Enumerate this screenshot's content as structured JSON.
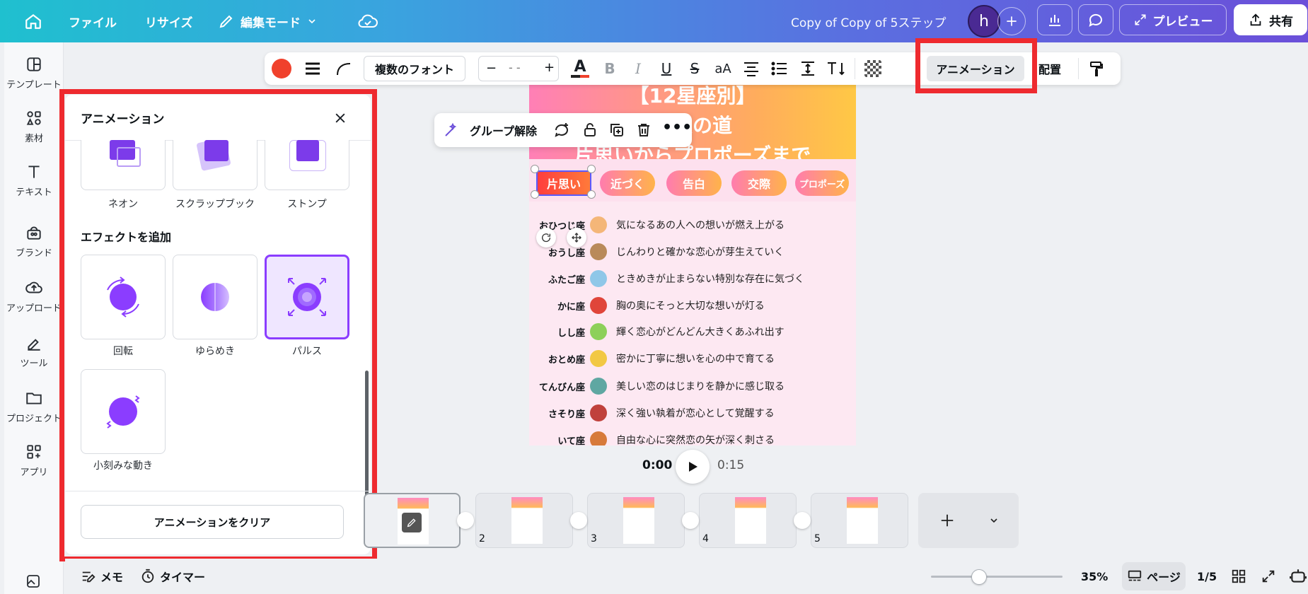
{
  "topbar": {
    "menu_file": "ファイル",
    "menu_resize": "リサイズ",
    "edit_mode": "編集モード",
    "doc_title": "Copy of Copy of 5ステップ",
    "avatar_initial": "h",
    "preview": "プレビュー",
    "share": "共有"
  },
  "sidebar": {
    "items": [
      {
        "label": "テンプレート",
        "icon": "template-icon"
      },
      {
        "label": "素材",
        "icon": "elements-icon"
      },
      {
        "label": "テキスト",
        "icon": "text-icon"
      },
      {
        "label": "ブランド",
        "icon": "brand-icon"
      },
      {
        "label": "アップロード",
        "icon": "upload-icon"
      },
      {
        "label": "ツール",
        "icon": "tools-icon"
      },
      {
        "label": "プロジェクト",
        "icon": "folder-icon"
      },
      {
        "label": "アプリ",
        "icon": "apps-icon"
      }
    ]
  },
  "panel": {
    "title": "アニメーション",
    "top_items": [
      "ネオン",
      "スクラップブック",
      "ストンプ"
    ],
    "section_title": "エフェクトを追加",
    "effects": [
      "回転",
      "ゆらめき",
      "パルス",
      "小刻みな動き"
    ],
    "selected_effect": "パルス",
    "clear_button": "アニメーションをクリア"
  },
  "toolbar": {
    "font": "複数のフォント",
    "size_minus": "−",
    "size_value": "- -",
    "size_plus": "+",
    "color_accent": "#f0412c",
    "animation": "アニメーション",
    "position": "配置",
    "font_case": "aA"
  },
  "context_menu": {
    "ungroup": "グループ解除"
  },
  "canvas": {
    "title_line1": "【12星座別】",
    "title_line2": "恋愛の道",
    "title_line3": "片思いからプロポーズまで",
    "steps": [
      "片思い",
      "近づく",
      "告白",
      "交際",
      "プロポーズ"
    ],
    "rows": [
      {
        "sign": "おひつじ座",
        "text": "気になるあの人への想いが燃え上がる",
        "color": "#f4b678"
      },
      {
        "sign": "おうし座",
        "text": "じんわりと確かな恋心が芽生えていく",
        "color": "#b98a5a"
      },
      {
        "sign": "ふたご座",
        "text": "ときめきが止まらない特別な存在に気づく",
        "color": "#8fc7e8"
      },
      {
        "sign": "かに座",
        "text": "胸の奥にそっと大切な想いが灯る",
        "color": "#e0453a"
      },
      {
        "sign": "しし座",
        "text": "輝く恋心がどんどん大きくあふれ出す",
        "color": "#8dd05a"
      },
      {
        "sign": "おとめ座",
        "text": "密かに丁寧に想いを心の中で育てる",
        "color": "#f2c844"
      },
      {
        "sign": "てんびん座",
        "text": "美しい恋のはじまりを静かに感じ取る",
        "color": "#5fa7a2"
      },
      {
        "sign": "さそり座",
        "text": "深く強い執着が恋心として覚醒する",
        "color": "#c0413c"
      },
      {
        "sign": "いて座",
        "text": "自由な心に突然恋の矢が深く刺さる",
        "color": "#d77a3a"
      }
    ]
  },
  "playback": {
    "current": "0:00",
    "total": "0:15"
  },
  "pages": [
    "2",
    "3",
    "4",
    "5"
  ],
  "bottombar": {
    "notes": "メモ",
    "timer": "タイマー",
    "zoom": "35%",
    "zoom_fraction": 0.35,
    "pages_label": "ページ",
    "page_count": "1/5"
  }
}
